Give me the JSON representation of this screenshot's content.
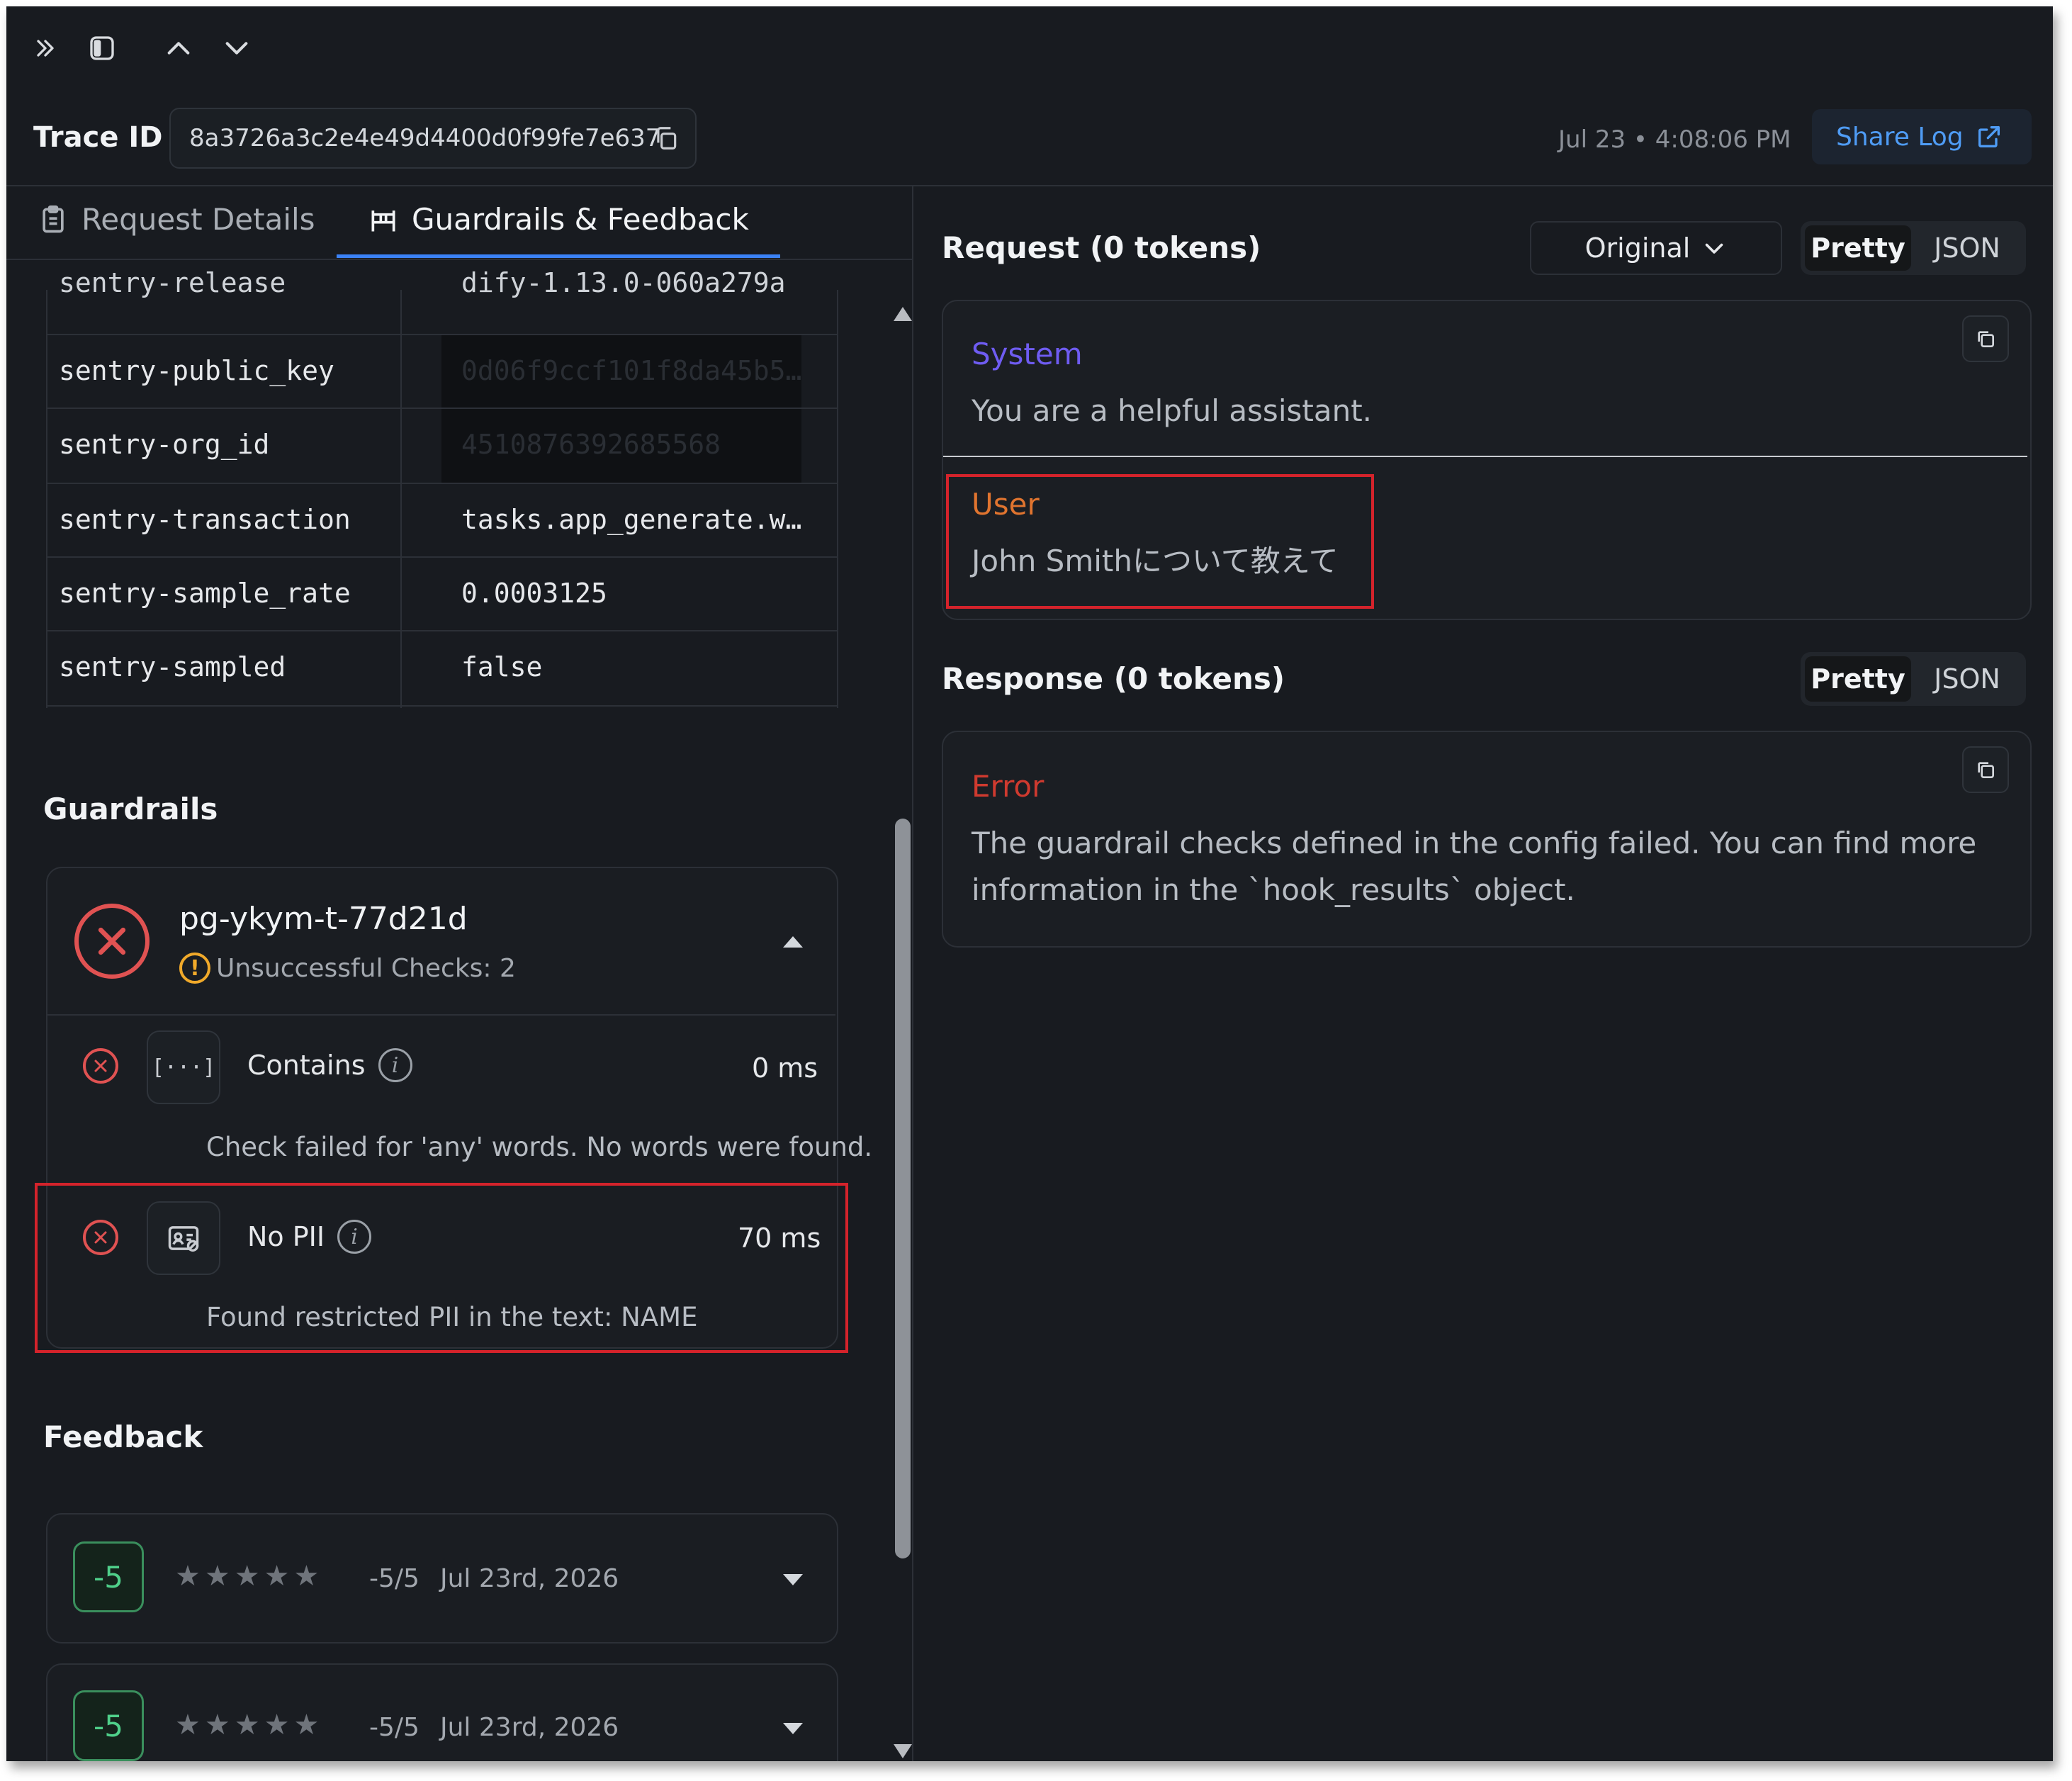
{
  "toolbar": {
    "icons": [
      "double-chevron-right-icon",
      "sidebar-panel-icon",
      "chevron-up-icon",
      "chevron-down-icon"
    ]
  },
  "header": {
    "trace_label": "Trace ID",
    "trace_id": "8a3726a3c2e4e49d4400d0f99fe7e637",
    "timestamp": "Jul 23 • 4:08:06 PM",
    "share_label": "Share Log"
  },
  "tabs": [
    {
      "label": "Request Details",
      "active": false
    },
    {
      "label": "Guardrails & Feedback",
      "active": true
    }
  ],
  "metadata_rows": [
    {
      "key": "sentry-release",
      "value": "dify-1.13.0-060a279a"
    },
    {
      "key": "sentry-public_key",
      "value": "0d06f9ccf101f8da45b5…"
    },
    {
      "key": "sentry-org_id",
      "value": "4510876392685568"
    },
    {
      "key": "sentry-transaction",
      "value": "tasks.app_generate.w…"
    },
    {
      "key": "sentry-sample_rate",
      "value": "0.0003125"
    },
    {
      "key": "sentry-sampled",
      "value": "false"
    }
  ],
  "guardrails": {
    "title": "Guardrails",
    "name": "pg-ykym-t-77d21d",
    "summary": "Unsuccessful Checks: 2",
    "checks": [
      {
        "name": "Contains",
        "duration": "0 ms",
        "message": "Check failed for 'any' words. No words were found.",
        "icon_text": "[···]"
      },
      {
        "name": "No PII",
        "duration": "70 ms",
        "message": "Found restricted PII in the text: NAME"
      }
    ]
  },
  "feedback": {
    "title": "Feedback",
    "items": [
      {
        "score": "-5",
        "rating": "-5/5",
        "date": "Jul 23rd, 2026"
      },
      {
        "score": "-5",
        "rating": "-5/5",
        "date": "Jul 23rd, 2026"
      }
    ]
  },
  "request": {
    "title": "Request (0 tokens)",
    "dropdown": "Original",
    "view_pretty": "Pretty",
    "view_json": "JSON",
    "messages": [
      {
        "role": "System",
        "content": "You are a helpful assistant.",
        "color": "#6f5cf2"
      },
      {
        "role": "User",
        "content": "John Smithについて教えて",
        "color": "#e0742f"
      }
    ]
  },
  "response": {
    "title": "Response (0 tokens)",
    "view_pretty": "Pretty",
    "view_json": "JSON",
    "role": "Error",
    "role_color": "#cf3a2f",
    "content_line1": "The guardrail checks defined in the config failed. You can find more",
    "content_line2": "information in the `hook_results` object."
  },
  "colors": {
    "background": "#181b20",
    "accent": "#3b82f6",
    "error": "#e05252",
    "highlight": "#d4232b",
    "score": "#4fd08a"
  }
}
